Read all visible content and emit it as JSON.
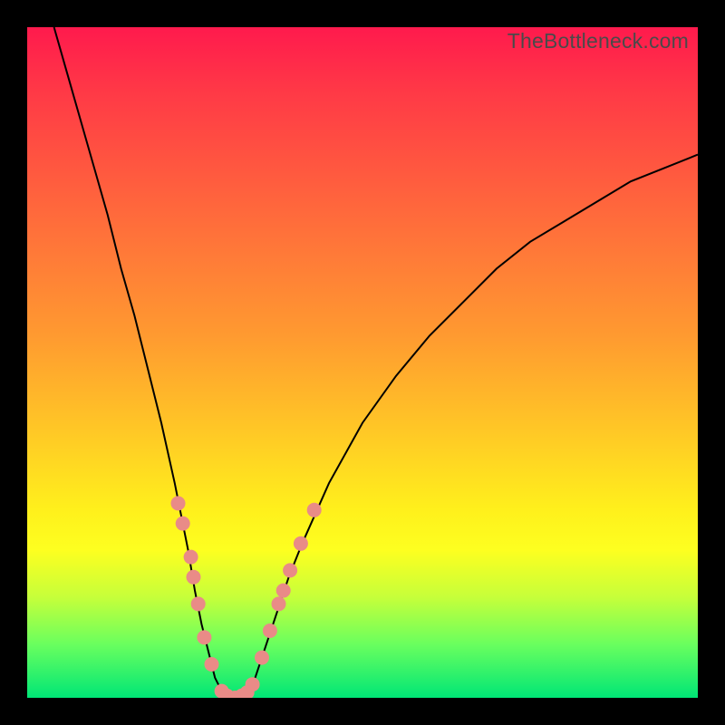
{
  "watermark": "TheBottleneck.com",
  "colors": {
    "frame_bg_top": "#ff1a4d",
    "frame_bg_bottom": "#00e676",
    "curve": "#000000",
    "points": "#e98b87",
    "page_bg": "#000000",
    "watermark_text": "#4a4a4a"
  },
  "chart_data": {
    "type": "line",
    "title": "",
    "xlabel": "",
    "ylabel": "",
    "xlim": [
      0,
      100
    ],
    "ylim": [
      0,
      100
    ],
    "series": [
      {
        "name": "curve",
        "x": [
          4,
          6,
          8,
          10,
          12,
          14,
          16,
          18,
          20,
          22,
          24,
          25,
          26,
          27,
          28,
          29,
          30,
          31,
          32,
          33,
          34,
          35,
          37,
          39,
          41,
          45,
          50,
          55,
          60,
          65,
          70,
          75,
          80,
          85,
          90,
          95,
          100
        ],
        "y": [
          100,
          93,
          86,
          79,
          72,
          64,
          57,
          49,
          41,
          32,
          22,
          16,
          11,
          7,
          3,
          1,
          0,
          0,
          0,
          1,
          3,
          6,
          12,
          18,
          23,
          32,
          41,
          48,
          54,
          59,
          64,
          68,
          71,
          74,
          77,
          79,
          81
        ]
      }
    ],
    "points": [
      {
        "x": 22.5,
        "y": 29
      },
      {
        "x": 23.2,
        "y": 26
      },
      {
        "x": 24.4,
        "y": 21
      },
      {
        "x": 24.8,
        "y": 18
      },
      {
        "x": 25.5,
        "y": 14
      },
      {
        "x": 26.4,
        "y": 9
      },
      {
        "x": 27.5,
        "y": 5
      },
      {
        "x": 29.0,
        "y": 1
      },
      {
        "x": 29.8,
        "y": 0.3
      },
      {
        "x": 31.0,
        "y": 0
      },
      {
        "x": 32.0,
        "y": 0.3
      },
      {
        "x": 32.8,
        "y": 0.8
      },
      {
        "x": 33.6,
        "y": 2
      },
      {
        "x": 35.0,
        "y": 6
      },
      {
        "x": 36.2,
        "y": 10
      },
      {
        "x": 37.5,
        "y": 14
      },
      {
        "x": 38.2,
        "y": 16
      },
      {
        "x": 39.2,
        "y": 19
      },
      {
        "x": 40.8,
        "y": 23
      },
      {
        "x": 42.8,
        "y": 28
      }
    ]
  }
}
